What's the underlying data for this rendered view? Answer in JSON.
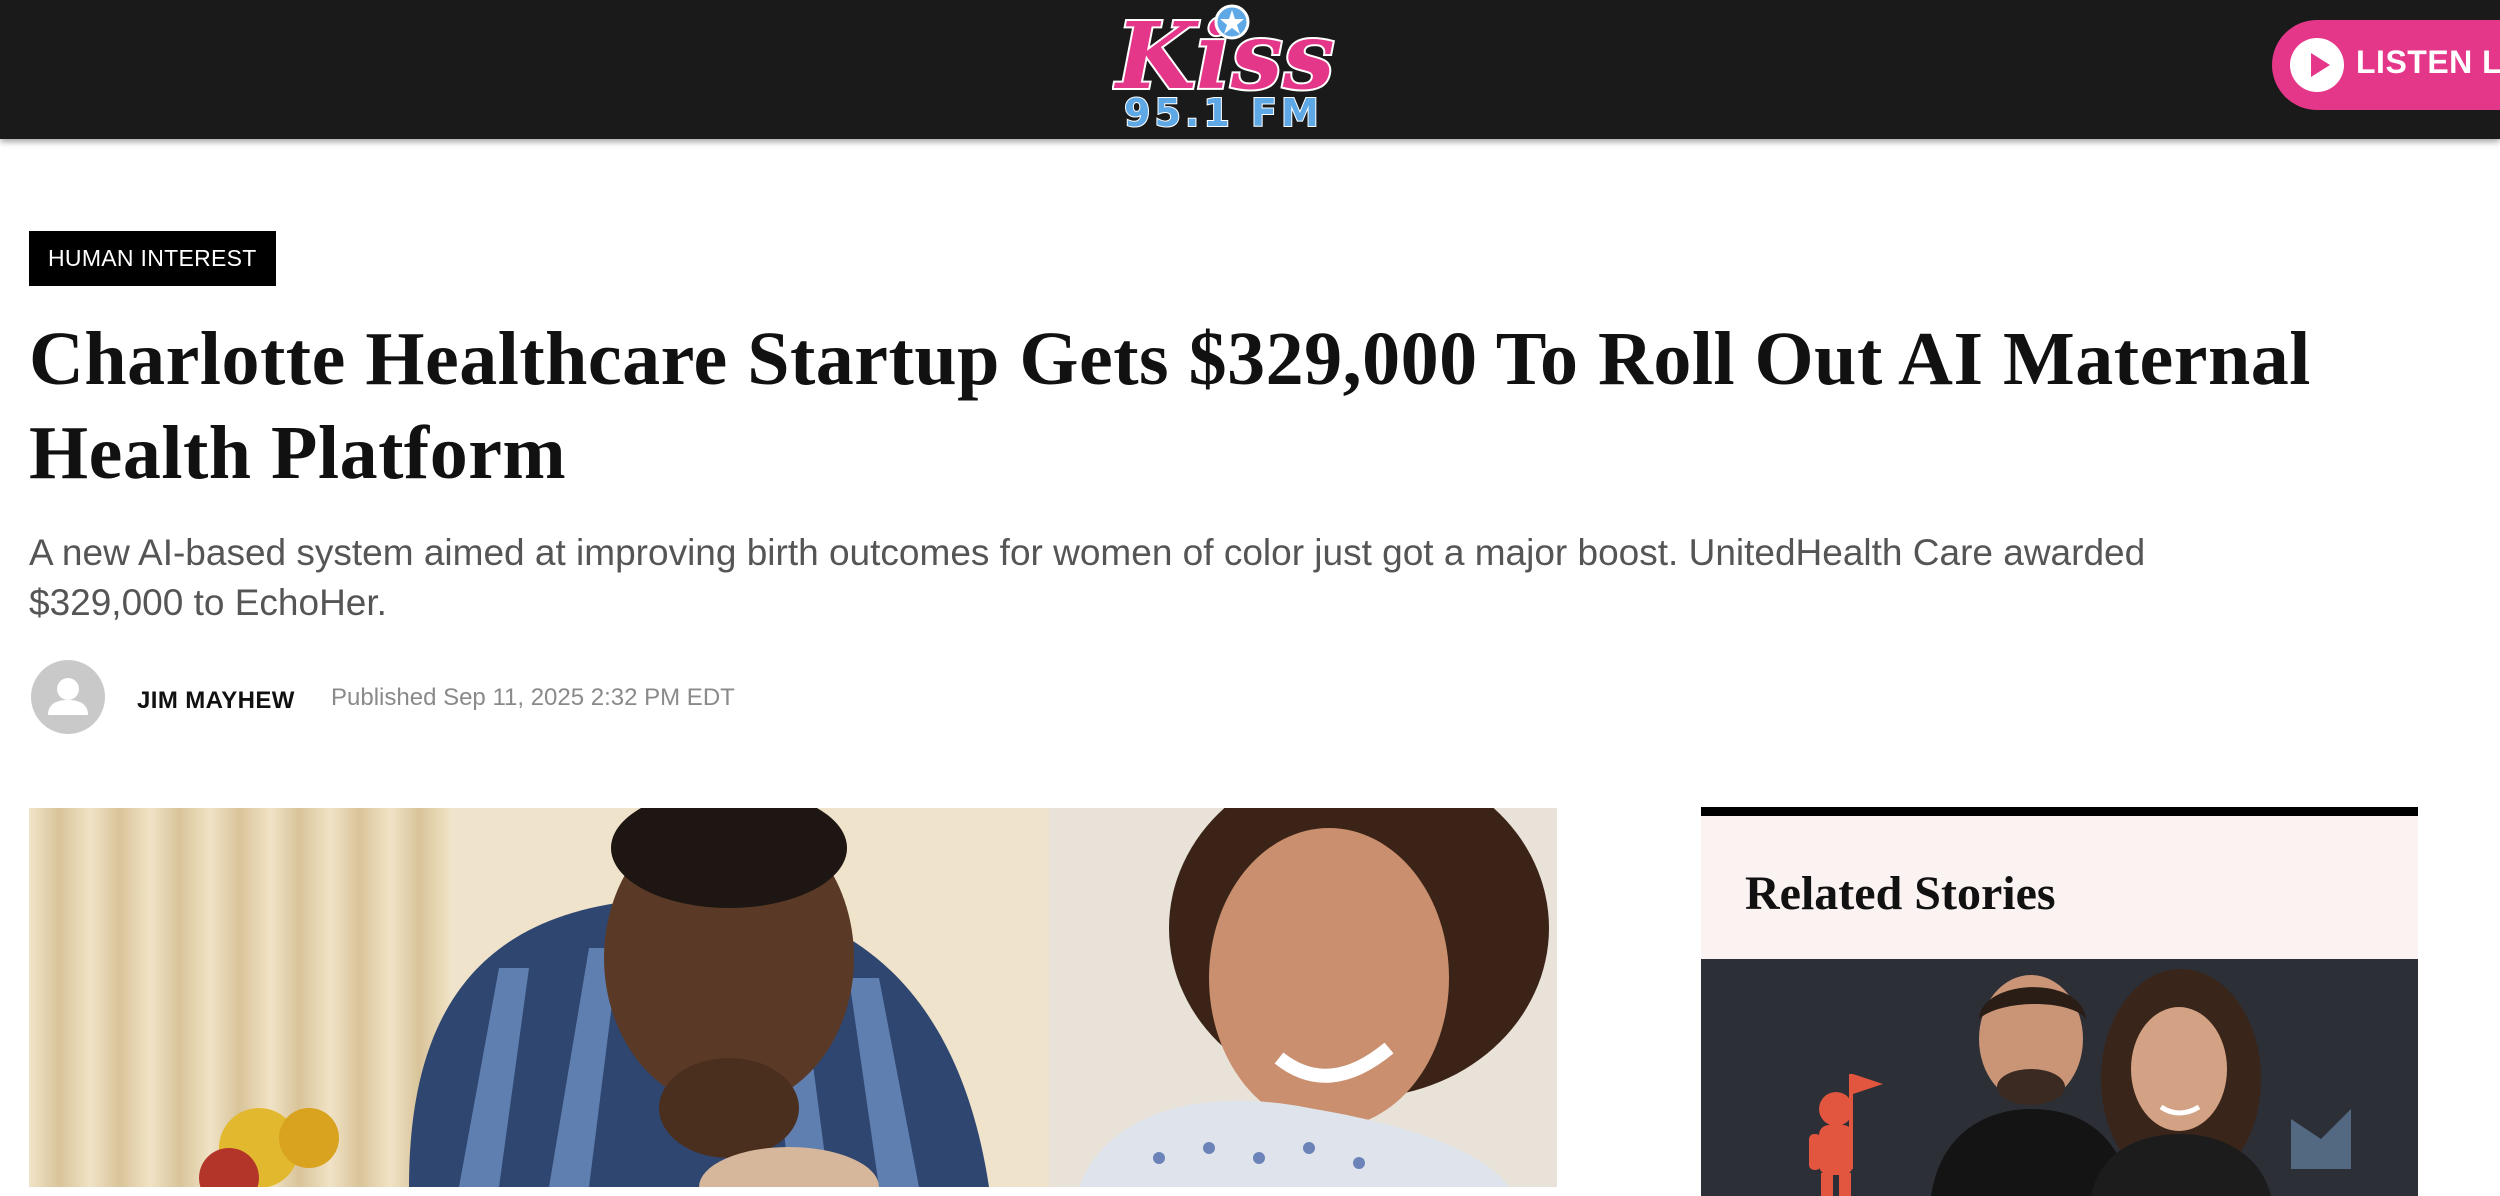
{
  "header": {
    "logo": {
      "wordmark": "Kiss",
      "frequency": "95.1 FM",
      "alt": "Kiss 95.1 FM logo"
    },
    "listen_label": "LISTEN LI",
    "colors": {
      "bar": "#1b1a1a",
      "brand_pink": "#e5378a",
      "logo_blue": "#5fa8e6"
    }
  },
  "article": {
    "category": "HUMAN INTEREST",
    "headline": "Charlotte Healthcare Startup Gets $329,000 To Roll Out AI Maternal Health Platform",
    "subhead": "A new AI-based system aimed at improving birth outcomes for women of color just got a major boost. UnitedHealth Care awarded $329,000 to EchoHer.",
    "author": "JIM MAYHEW",
    "published": "Published Sep 11, 2025 2:32 PM EDT",
    "avatar_icon": "user-silhouette-icon",
    "hero_image": "photo of a man kissing a newborn held by a smiling woman in a hospital gown"
  },
  "sidebar": {
    "related_title": "Related Stories",
    "related_image": "photo of a couple posing in front of a backdrop with an astronaut-with-flag logo"
  }
}
